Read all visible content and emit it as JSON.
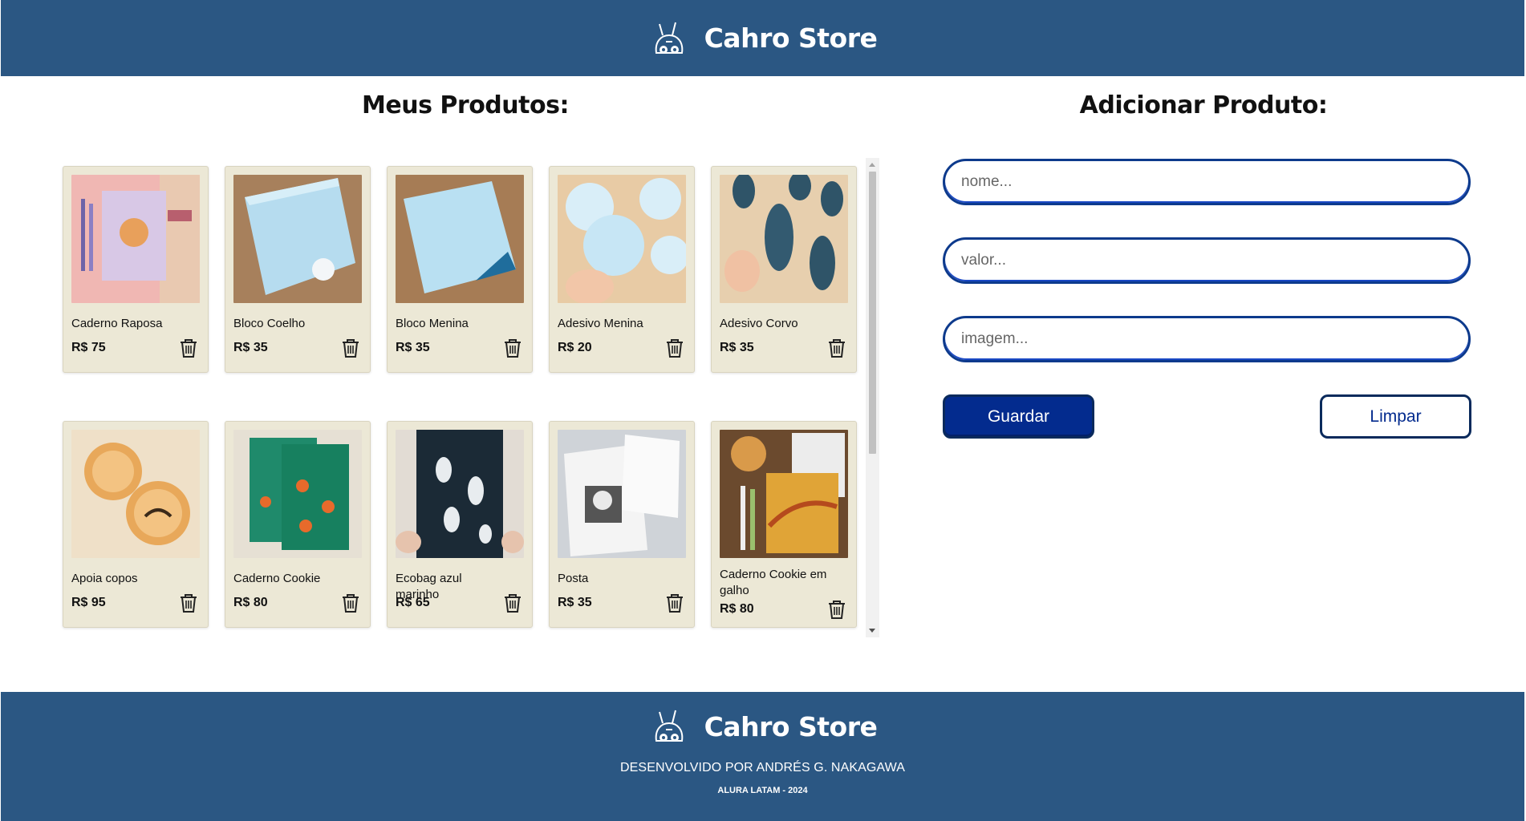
{
  "header": {
    "brand": "Cahro Store",
    "logo_icon": "bunny-logo-icon"
  },
  "products_section": {
    "title": "Meus Produtos:"
  },
  "add_section": {
    "title": "Adicionar Produto:",
    "fields": {
      "nome_placeholder": "nome...",
      "valor_placeholder": "valor...",
      "imagem_placeholder": "imagem..."
    },
    "buttons": {
      "save": "Guardar",
      "clear": "Limpar"
    }
  },
  "products": [
    {
      "name": "Caderno Raposa",
      "price": "R$ 75"
    },
    {
      "name": "Bloco Coelho",
      "price": "R$ 35"
    },
    {
      "name": "Bloco Menina",
      "price": "R$ 35"
    },
    {
      "name": "Adesivo Menina",
      "price": "R$ 20"
    },
    {
      "name": "Adesivo Corvo",
      "price": "R$ 35"
    },
    {
      "name": "Apoia copos",
      "price": "R$ 95"
    },
    {
      "name": "Caderno Cookie",
      "price": "R$ 80"
    },
    {
      "name": "Ecobag azul marinho",
      "price": "R$ 65"
    },
    {
      "name": "Posta",
      "price": "R$ 35"
    },
    {
      "name": "Caderno Cookie em galho",
      "price": "R$ 80"
    }
  ],
  "footer": {
    "brand": "Cahro Store",
    "developer": "DESENVOLVIDO POR ANDRÉS G. NAKAGAWA",
    "copyright": "ALURA LATAM - 2024"
  },
  "colors": {
    "header_bg": "#2b5783",
    "card_bg": "#ece8d6",
    "button_primary": "#032b8e",
    "field_border": "#0d3a8c"
  }
}
